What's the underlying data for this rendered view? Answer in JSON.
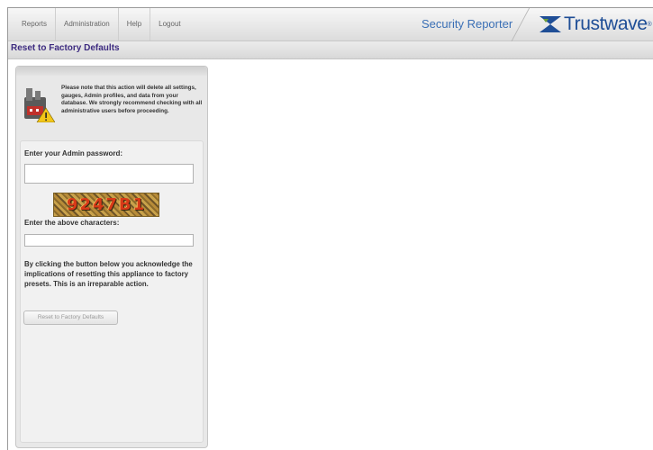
{
  "nav": {
    "items": [
      "Reports",
      "Administration",
      "Help",
      "Logout"
    ]
  },
  "header": {
    "product_name": "Security Reporter",
    "brand": "Trustwave",
    "brand_reg": "®"
  },
  "page": {
    "title": "Reset to Factory Defaults"
  },
  "warning": {
    "text": "Please note that this action will delete all settings, gauges, Admin profiles, and data from your database. We strongly recommend checking with all administrative users before proceeding.",
    "icon": "factory-warning-icon"
  },
  "form": {
    "password_label": "Enter your Admin password:",
    "password_value": "",
    "captcha_text": "9247B1",
    "captcha_label": "Enter the above characters:",
    "captcha_value": "",
    "acknowledgement": "By clicking the button below you acknowledge the implications of resetting this appliance to factory presets. This is an irreparable action.",
    "reset_button_label": "Reset to Factory Defaults"
  },
  "colors": {
    "brand": "#1f4e96",
    "product": "#3a6fb5",
    "title": "#3d2b80",
    "captcha_digits": "#d83a18"
  }
}
